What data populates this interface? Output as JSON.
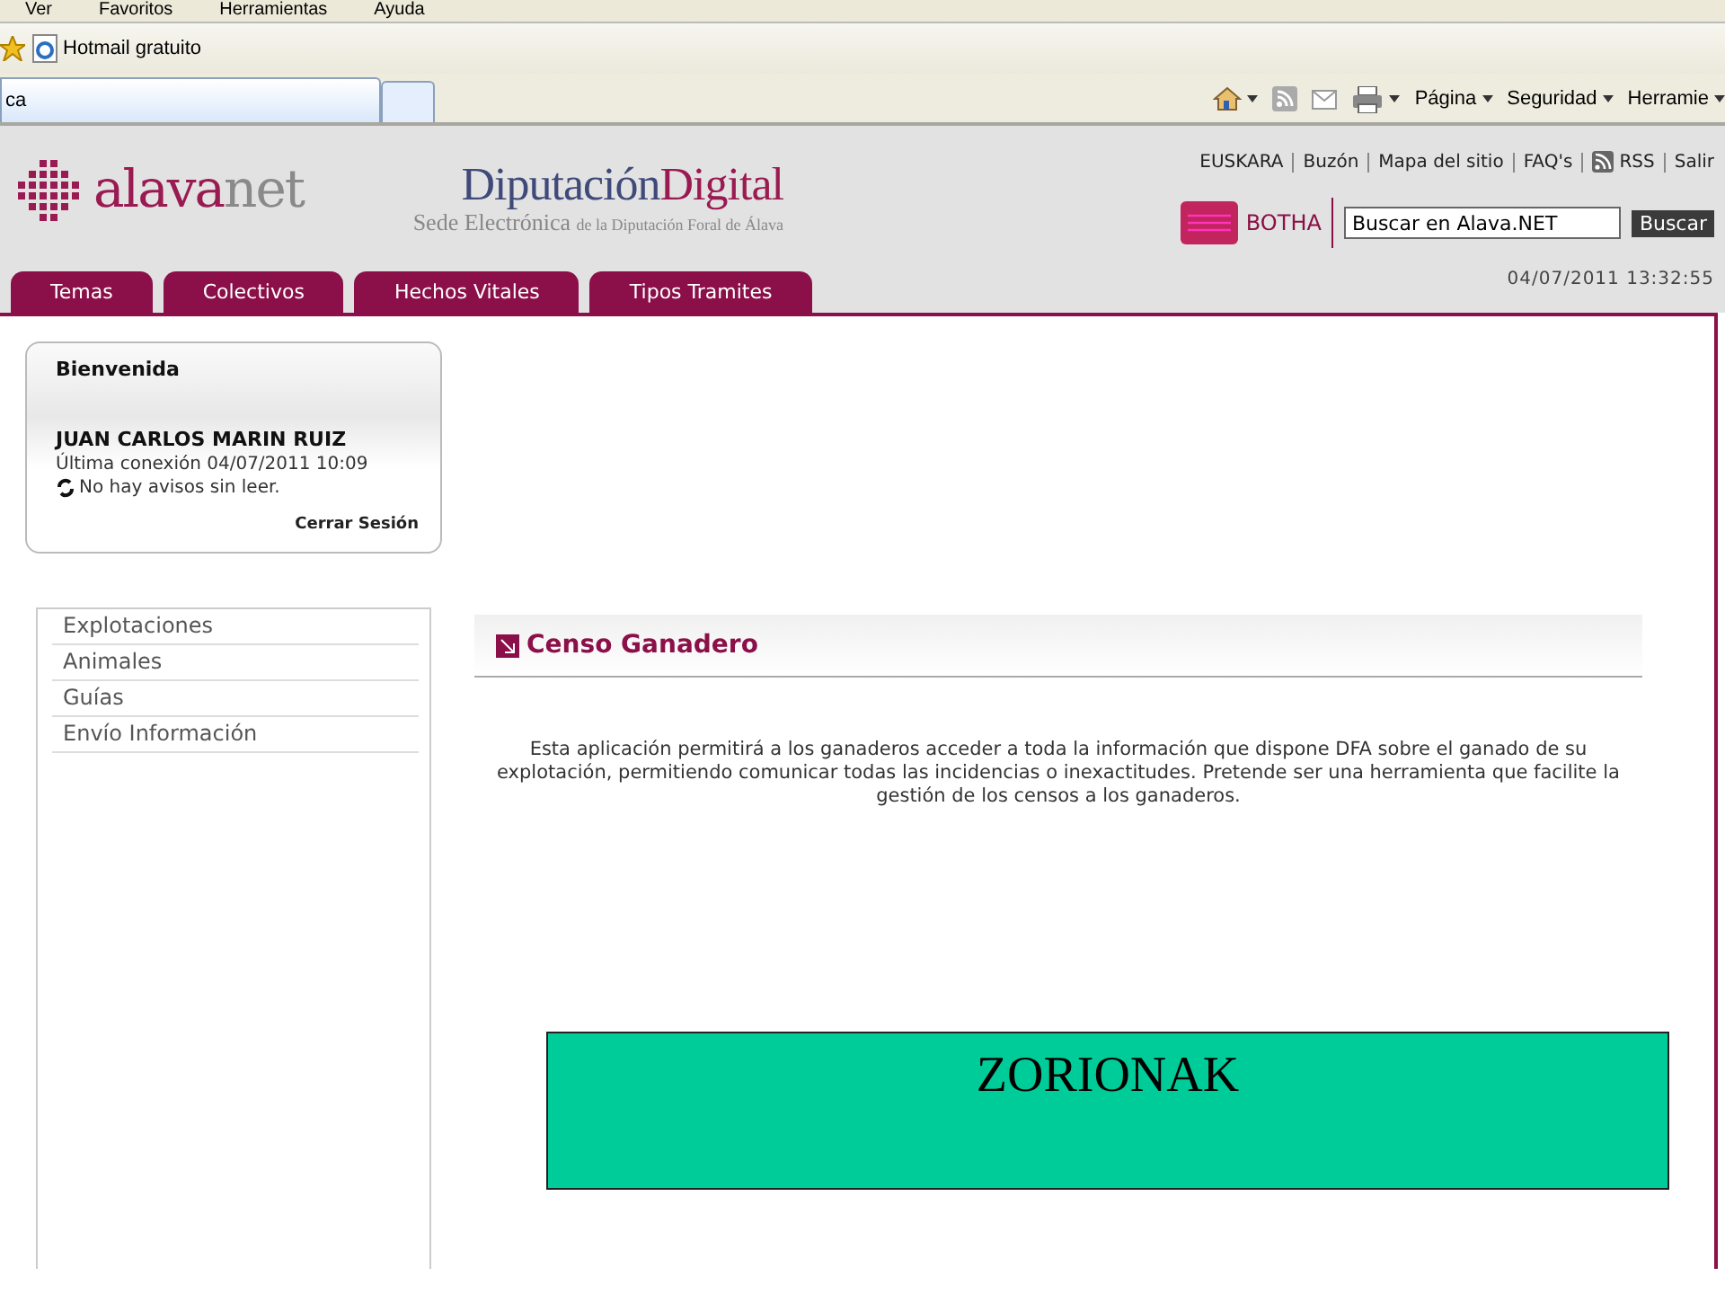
{
  "browser": {
    "menu": [
      "Ver",
      "Favoritos",
      "Herramientas",
      "Ayuda"
    ],
    "favorites": [
      "Hotmail gratuito"
    ],
    "tab": {
      "title": "ca"
    },
    "commands": [
      {
        "kind": "home"
      },
      {
        "kind": "feed"
      },
      {
        "kind": "mail"
      },
      {
        "kind": "print"
      },
      {
        "kind": "text",
        "label": "Página"
      },
      {
        "kind": "text",
        "label": "Seguridad"
      },
      {
        "kind": "text",
        "label": "Herramie"
      }
    ]
  },
  "header": {
    "logo": {
      "main": "alava",
      "accent": "net"
    },
    "title": {
      "part1": "Diputación",
      "part2": "Digital",
      "subtitle_large": "Sede Electrónica",
      "subtitle_small": "de la Diputación Foral de Álava"
    },
    "links": [
      {
        "label": "EUSKARA",
        "icon": false
      },
      {
        "label": "Buzón",
        "icon": false
      },
      {
        "label": "Mapa del sitio",
        "icon": false
      },
      {
        "label": "FAQ's",
        "icon": false
      },
      {
        "label": "RSS",
        "icon": true
      },
      {
        "label": "Salir",
        "icon": false
      }
    ],
    "botha": "BOTHA",
    "search": {
      "value": "Buscar en Alava.NET",
      "button": "Buscar"
    },
    "tabs": [
      "Temas",
      "Colectivos",
      "Hechos Vitales",
      "Tipos Tramites"
    ],
    "datetime": "04/07/2011 13:32:55"
  },
  "welcome": {
    "title": "Bienvenida",
    "user": "JUAN CARLOS MARIN RUIZ",
    "last_login": "Última conexión 04/07/2011 10:09",
    "notices": "No hay avisos sin leer.",
    "logout": "Cerrar Sesión"
  },
  "sidebar": {
    "items": [
      "Explotaciones",
      "Animales",
      "Guías",
      "Envío Información"
    ]
  },
  "main": {
    "title": "Censo Ganadero",
    "description": "Esta aplicación permitirá a los ganaderos acceder a toda la información que dispone DFA sobre el ganado de su explotación, permitiendo comunicar todas las incidencias o inexactitudes. Pretende ser una herramienta que facilite la gestión de los censos a los ganaderos.",
    "banner": "ZORIONAK"
  }
}
